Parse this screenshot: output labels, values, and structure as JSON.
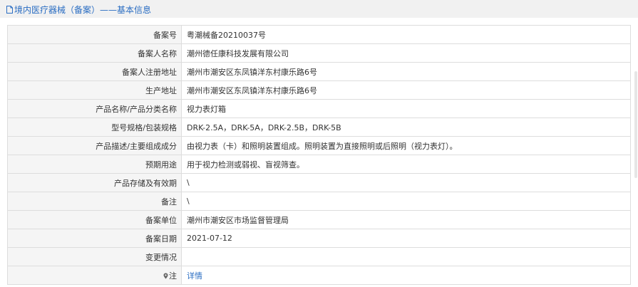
{
  "header": {
    "title": "境内医疗器械（备案）——基本信息",
    "icon": "document-icon"
  },
  "rows": [
    {
      "label": "备案号",
      "value": "粤潮械备20210037号"
    },
    {
      "label": "备案人名称",
      "value": "潮州德任康科技发展有限公司"
    },
    {
      "label": "备案人注册地址",
      "value": "潮州市潮安区东凤镇洋东村康乐路6号"
    },
    {
      "label": "生产地址",
      "value": "潮州市潮安区东凤镇洋东村康乐路6号"
    },
    {
      "label": "产品名称/产品分类名称",
      "value": "视力表灯箱"
    },
    {
      "label": "型号规格/包装规格",
      "value": "DRK-2.5A，DRK-5A，DRK-2.5B，DRK-5B"
    },
    {
      "label": "产品描述/主要组成成分",
      "value": "由视力表（卡）和照明装置组成。照明装置为直接照明或后照明（视力表灯）。"
    },
    {
      "label": "预期用途",
      "value": "用于视力检测或弱视、盲视筛查。"
    },
    {
      "label": "产品存储及有效期",
      "value": "\\"
    },
    {
      "label": "备注",
      "value": "\\"
    },
    {
      "label": "备案单位",
      "value": "潮州市潮安区市场监督管理局"
    },
    {
      "label": "备案日期",
      "value": "2021-07-12"
    },
    {
      "label": "变更情况",
      "value": ""
    }
  ],
  "note_row": {
    "label": "注",
    "icon": "pin-icon",
    "link": "详情"
  },
  "colors": {
    "accent": "#2a6dc2",
    "label_bg": "#f5f5f5",
    "border": "#dddddd",
    "header_bg": "#f1f1f1"
  }
}
